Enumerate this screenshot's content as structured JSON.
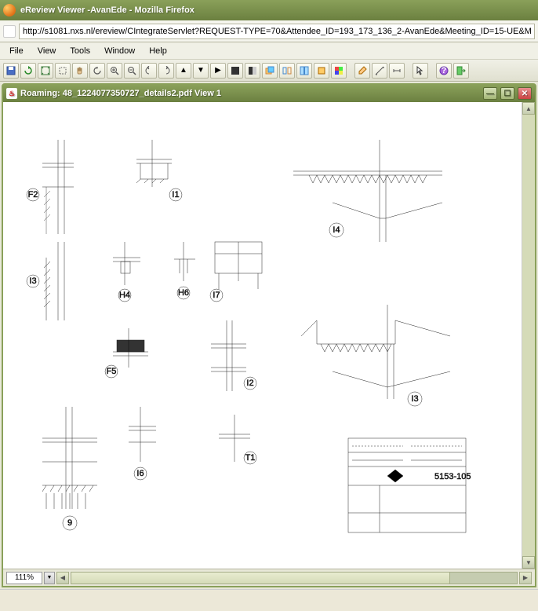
{
  "window": {
    "title": "eReview Viewer -AvanEde - Mozilla Firefox"
  },
  "url": {
    "value": "http://s1081.nxs.nl/ereview/CIntegrateServlet?REQUEST-TYPE=70&Attendee_ID=193_173_136_2-AvanEde&Meeting_ID=15-UE&ME"
  },
  "menu": {
    "file": "File",
    "view": "View",
    "tools": "Tools",
    "window": "Window",
    "help": "Help"
  },
  "doc": {
    "title": "Roaming: 48_1224077350727_details2.pdf View 1"
  },
  "zoom": {
    "value": "111%"
  },
  "labels": {
    "f2": "F2",
    "i1": "I1",
    "i3": "I3",
    "h4": "H4",
    "h6": "H6",
    "i7": "I7",
    "f5": "F5",
    "i2": "I2",
    "i6": "I6",
    "i4high": "I4",
    "i3low": "I3",
    "ninth": "9",
    "t1": "T1",
    "titleblock": "5153-105"
  }
}
